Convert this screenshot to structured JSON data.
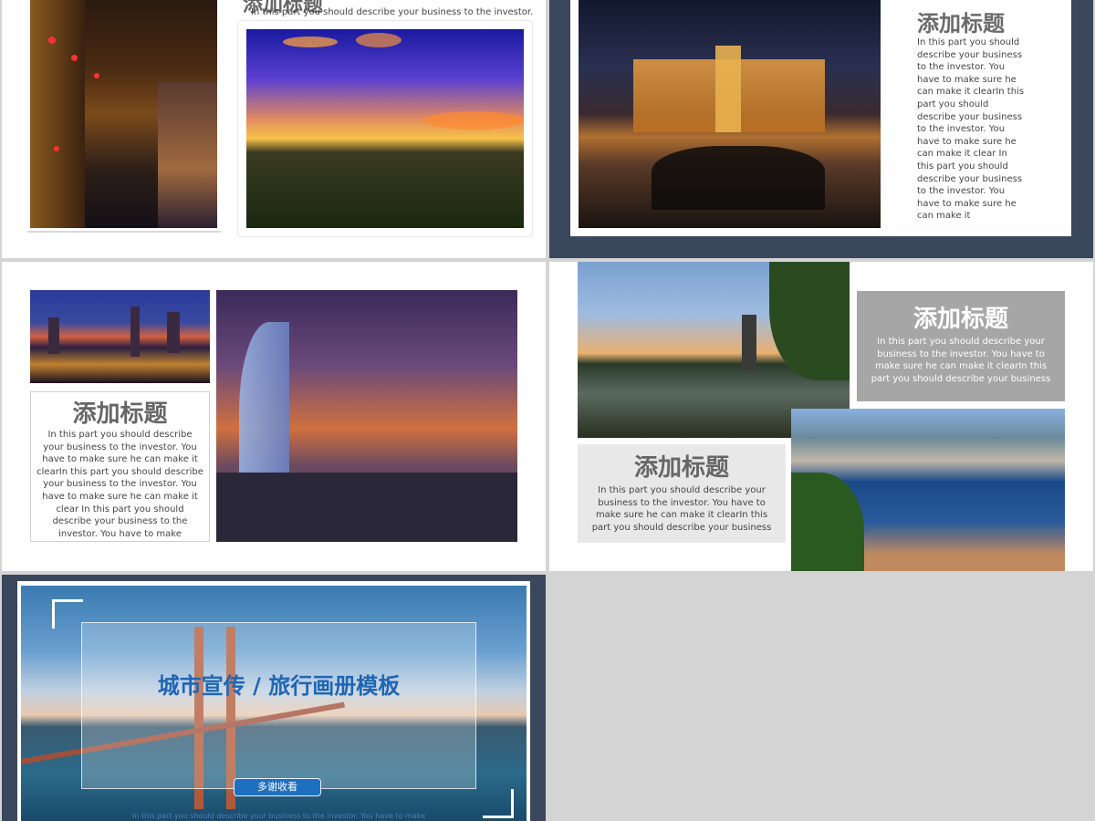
{
  "slide1": {
    "title": "添加标题",
    "text": "In this part you should describe your business to the investor."
  },
  "slide2": {
    "title": "添加标题",
    "text": "In this part you should describe your business to the investor. You have to make sure he can make it clearIn this part you should describe your business to the investor. You have to make sure he can make it clear In this part you should describe your business to the investor. You have to make sure he can make it"
  },
  "slide3": {
    "title": "添加标题",
    "text": "In this part you should describe your business to the investor. You have to make sure he can make it clearIn this part you should describe your business to the investor. You have to make sure he can make it clear In this part you should describe your business to the investor. You have to make"
  },
  "slide4": {
    "box1_title": "添加标题",
    "box1_text": "In this part you should describe your business to the investor. You have to make sure he can make it clearIn this part you should describe your business",
    "box2_title": "添加标题",
    "box2_text": "In this part you should describe your business to the investor. You have to make sure he can make it clearIn this part you should describe your business"
  },
  "slide5": {
    "title": "城市宣传 / 旅行画册模板",
    "button": "多谢收看",
    "footnote": "In this part you should describe your business to the investor. You have to make"
  },
  "colors": {
    "navy": "#3a475c",
    "grey_box": "#a6a6a6",
    "light_box": "#e8e8e8",
    "title_blue": "#1f66b4",
    "button_blue": "#1e6fc0"
  }
}
